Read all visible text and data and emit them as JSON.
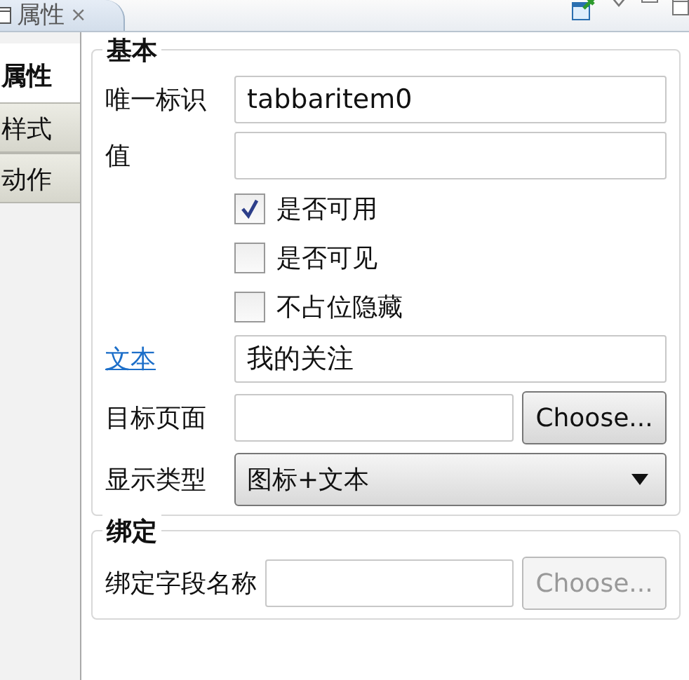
{
  "view_tab": {
    "label": "属性",
    "close": "×"
  },
  "side_tabs": [
    {
      "label": "属性",
      "selected": true
    },
    {
      "label": "样式",
      "selected": false
    },
    {
      "label": "动作",
      "selected": false
    }
  ],
  "groups": [
    {
      "title": "基本",
      "rows": [
        {
          "kind": "field",
          "label": "唯一标识",
          "value": "tabbaritem0"
        },
        {
          "kind": "field",
          "label": "值"
        },
        {
          "kind": "checkbox",
          "label": "是否可用",
          "checked": true
        },
        {
          "kind": "checkbox",
          "label": "是否可见",
          "checked": false
        },
        {
          "kind": "checkbox",
          "label": "不占位隐藏",
          "checked": false
        },
        {
          "kind": "link-field",
          "label": "文本",
          "value": "我的关注"
        },
        {
          "kind": "field-button",
          "label": "目标页面",
          "button": "Choose...",
          "disabled": false
        },
        {
          "kind": "select",
          "label": "显示类型",
          "value": "图标+文本"
        }
      ]
    },
    {
      "title": "绑定",
      "rows": [
        {
          "kind": "field-button",
          "label": "绑定字段名称",
          "button": "Choose...",
          "disabled": true
        }
      ]
    }
  ]
}
